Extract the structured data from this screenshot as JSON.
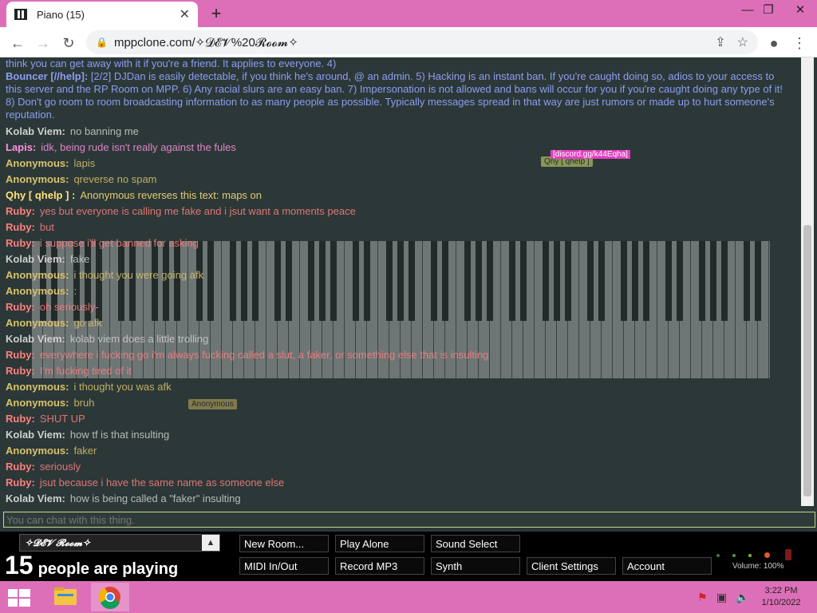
{
  "browser": {
    "tab_title": "Piano (15)",
    "new_tab_symbol": "+",
    "url": "mppclone.com/✧𝓓𝓔𝓥%20𝓡𝓸𝓸𝓶✧"
  },
  "chat": {
    "bouncer_top": "think you can get away with it if you're a friend. It applies to everyone. 4)",
    "bouncer_name": "Bouncer [//help]:",
    "bouncer_text": "[2/2] DJDan is easily detectable, if you think he's around, @ an admin. 5) Hacking is an instant ban. If you're caught doing so, adios to your access to this server and the RP Room on MPP. 6) Any racial slurs are an easy ban. 7) Impersonation is not allowed and bans will occur for you if you're caught doing any type of it! 8) Don't go room to room broadcasting information to as many people as possible. Typically messages spread in that way are just rumors or made up to hurt someone's reputation.",
    "messages": [
      {
        "name": "Kolab Viem:",
        "text": "no banning me"
      },
      {
        "name": "Lapis:",
        "text": "idk, being rude isn't really against the fules"
      },
      {
        "name": "Anonymous:",
        "text": "lapis"
      },
      {
        "name": "Anonymous:",
        "text": "qreverse no spam"
      },
      {
        "name": "Qhy [ qhelp ] :",
        "text": "Anonymous reverses this text: maps on"
      },
      {
        "name": "Ruby:",
        "text": "yes but everyone is calling me fake and i jsut want a moments peace"
      },
      {
        "name": "Ruby:",
        "text": "but"
      },
      {
        "name": "Ruby:",
        "text": "i suppose i'll get banned for asking"
      },
      {
        "name": "Kolab Viem:",
        "text": "fake"
      },
      {
        "name": "Anonymous:",
        "text": "i thought you were going afk"
      },
      {
        "name": "Anonymous:",
        "text": ":"
      },
      {
        "name": "Ruby:",
        "text": "oh seriously-"
      },
      {
        "name": "Anonymous:",
        "text": "go afk"
      },
      {
        "name": "Kolab Viem:",
        "text": "kolab viem does a little trolling"
      },
      {
        "name": "Ruby:",
        "text": "everywhere i fucking go i'm always fucking called a slut, a faker, or something else that is insulting"
      },
      {
        "name": "Ruby:",
        "text": "I'm fucking tired of it"
      },
      {
        "name": "Anonymous:",
        "text": "i thought you was afk"
      },
      {
        "name": "Anonymous:",
        "text": "bruh"
      },
      {
        "name": "Ruby:",
        "text": "SHUT UP"
      },
      {
        "name": "Kolab Viem:",
        "text": "how tf is that insulting"
      },
      {
        "name": "Anonymous:",
        "text": "faker"
      },
      {
        "name": "Ruby:",
        "text": "seriously"
      },
      {
        "name": "Ruby:",
        "text": "jsut because i have the same name as someone else"
      },
      {
        "name": "Kolab Viem:",
        "text": "how is being called a \"faker\" insulting"
      }
    ],
    "input_placeholder": "You can chat with this thing.",
    "floating_labels": [
      "Qhy [ qhelp ]",
      "Anonymous",
      "[discord.gg/k44Eqha]"
    ]
  },
  "bottom": {
    "room_name": "✧𝓓𝓔𝓥 𝓡𝓸𝓸𝓶✧",
    "people_count": "15",
    "people_label": "people are playing",
    "buttons": {
      "new_room": "New Room...",
      "play_alone": "Play Alone",
      "sound_select": "Sound Select",
      "midi": "MIDI In/Out",
      "record": "Record MP3",
      "synth": "Synth",
      "client_settings": "Client Settings",
      "account": "Account"
    },
    "volume": "Volume: 100%"
  },
  "taskbar": {
    "time": "3:22 PM",
    "date": "1/10/2022"
  },
  "colors": {
    "chrome": "#dd6fb8",
    "page_bg": "#2c3838",
    "kolab": "#cfcfcf",
    "lapis": "#ff8fe0",
    "anonymous": "#d8c36a",
    "qhy": "#ffe27a",
    "ruby": "#ff7f7f",
    "bouncer": "#8c9df0"
  }
}
